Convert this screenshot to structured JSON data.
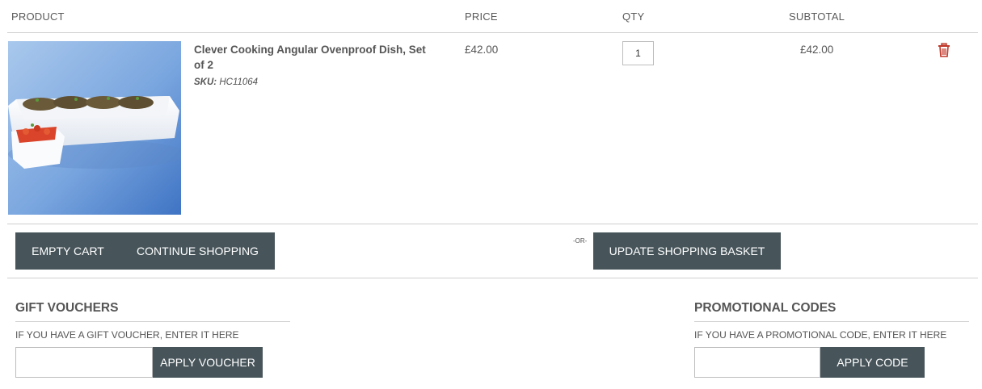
{
  "header": {
    "product": "PRODUCT",
    "price": "PRICE",
    "qty": "QTY",
    "subtotal": "SUBTOTAL"
  },
  "item": {
    "name": "Clever Cooking Angular Ovenproof Dish, Set of 2",
    "sku_label": "SKU:",
    "sku": "HC11064",
    "price": "£42.00",
    "qty": "1",
    "subtotal": "£42.00",
    "image_icon": "product-photo",
    "remove_icon": "trash-icon"
  },
  "actions": {
    "empty_cart": "EMPTY CART",
    "continue_shopping": "CONTINUE SHOPPING",
    "or": "-OR-",
    "update_basket": "UPDATE SHOPPING BASKET"
  },
  "gift": {
    "title": "GIFT VOUCHERS",
    "hint": "IF YOU HAVE A GIFT VOUCHER, ENTER IT HERE",
    "value": "",
    "button": "APPLY VOUCHER"
  },
  "promo": {
    "title": "PROMOTIONAL CODES",
    "hint": "IF YOU HAVE A PROMOTIONAL CODE, ENTER IT HERE",
    "value": "",
    "button": "APPLY CODE"
  },
  "colors": {
    "button_bg": "#47555b",
    "trash": "#c0392b",
    "divider": "#cfcfcf"
  }
}
